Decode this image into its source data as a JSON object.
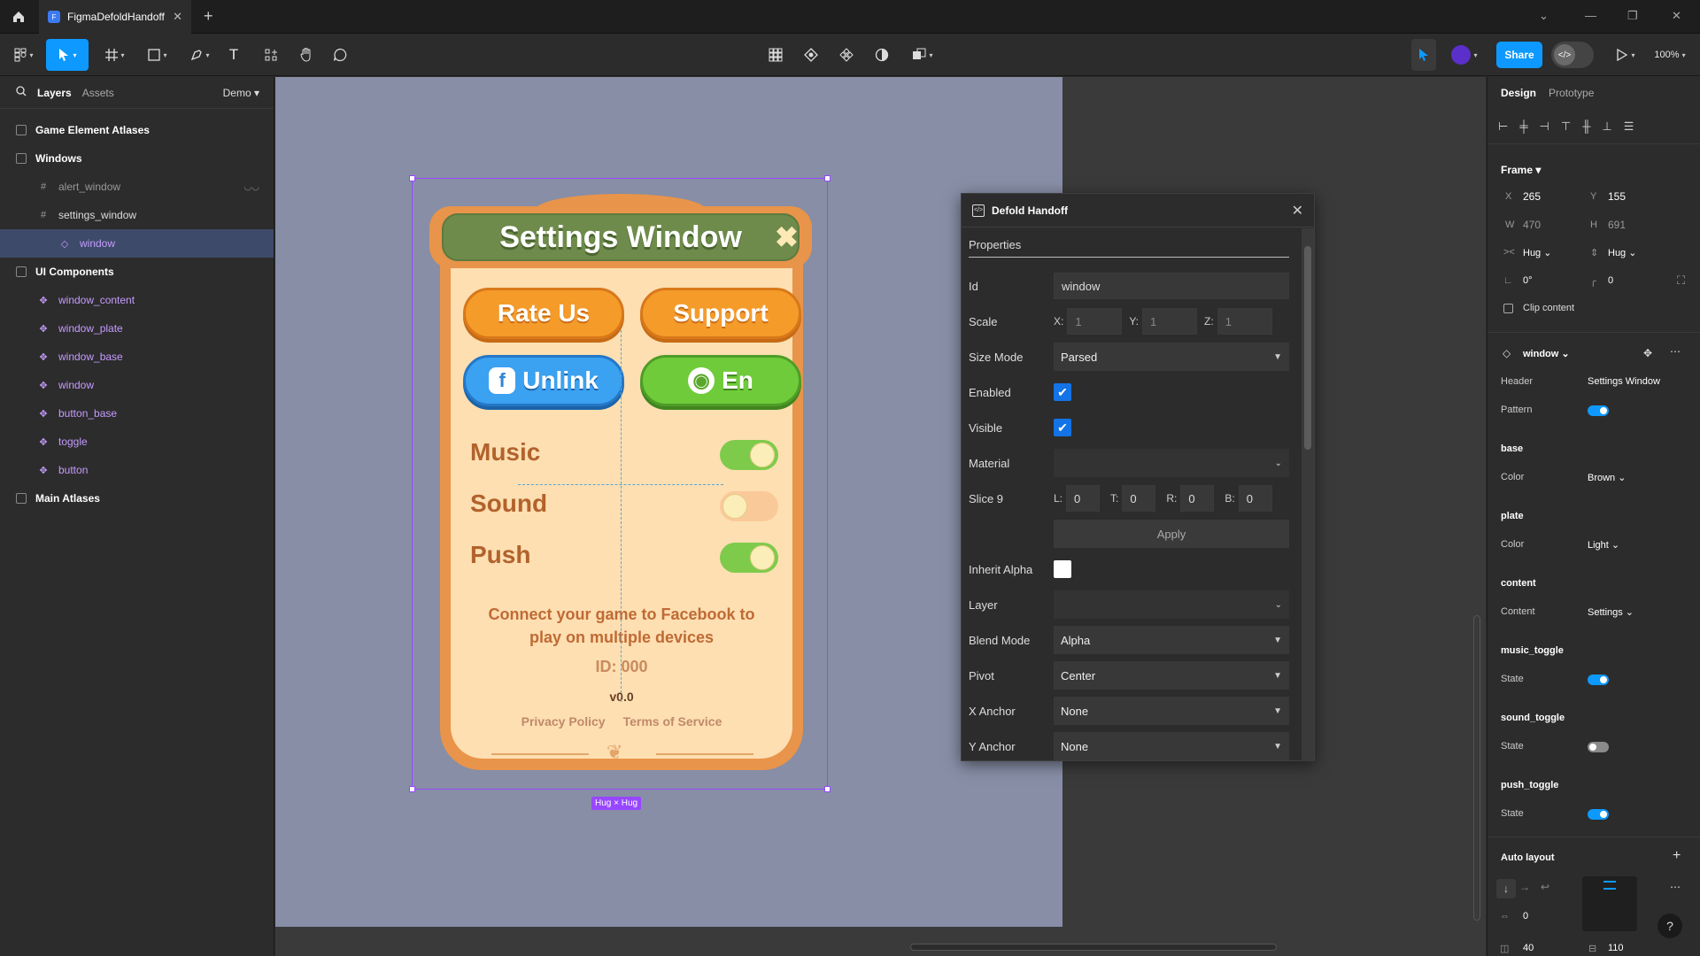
{
  "tabbar": {
    "tab_title": "FigmaDefoldHandoff",
    "tab_icon": "F"
  },
  "toolbar": {
    "share_label": "Share",
    "zoom": "100%"
  },
  "left": {
    "tabs": [
      "Layers",
      "Assets"
    ],
    "page_select": "Demo",
    "layers": [
      {
        "label": "Game Element Atlases"
      },
      {
        "label": "Windows"
      },
      {
        "label": "alert_window"
      },
      {
        "label": "settings_window"
      },
      {
        "label": "window"
      },
      {
        "label": "UI Components"
      },
      {
        "label": "window_content"
      },
      {
        "label": "window_plate"
      },
      {
        "label": "window_base"
      },
      {
        "label": "window"
      },
      {
        "label": "button_base"
      },
      {
        "label": "toggle"
      },
      {
        "label": "button"
      },
      {
        "label": "Main Atlases"
      }
    ]
  },
  "game": {
    "title": "Settings Window",
    "buttons": [
      "Rate Us",
      "Support",
      "Unlink",
      "En"
    ],
    "toggles": [
      {
        "label": "Music",
        "on": true
      },
      {
        "label": "Sound",
        "on": false
      },
      {
        "label": "Push",
        "on": true
      }
    ],
    "message": "Connect your game to Facebook to play on multiple devices",
    "id_text": "ID: 000",
    "version": "v0.0",
    "privacy": "Privacy Policy",
    "terms": "Terms of Service",
    "hug_label": "Hug × Hug"
  },
  "plugin": {
    "title": "Defold Handoff",
    "section": "Properties",
    "id_label": "Id",
    "id_value": "window",
    "scale_label": "Scale",
    "scale_x": "1",
    "scale_y": "1",
    "scale_z": "1",
    "size_mode_label": "Size Mode",
    "size_mode": "Parsed",
    "enabled_label": "Enabled",
    "visible_label": "Visible",
    "material_label": "Material",
    "slice_label": "Slice 9",
    "slice_l": "0",
    "slice_t": "0",
    "slice_r": "0",
    "slice_b": "0",
    "apply_label": "Apply",
    "inherit_label": "Inherit Alpha",
    "layer_label": "Layer",
    "blend_label": "Blend Mode",
    "blend": "Alpha",
    "pivot_label": "Pivot",
    "pivot": "Center",
    "xanchor_label": "X Anchor",
    "xanchor": "None",
    "yanchor_label": "Y Anchor",
    "yanchor": "None",
    "axis": {
      "x": "X:",
      "y": "Y:",
      "z": "Z:",
      "l": "L:",
      "t": "T:",
      "r": "R:",
      "b": "B:"
    }
  },
  "right": {
    "tabs": [
      "Design",
      "Prototype"
    ],
    "frame_label": "Frame",
    "x_lab": "X",
    "x": "265",
    "y_lab": "Y",
    "y": "155",
    "w_lab": "W",
    "w": "470",
    "h_lab": "H",
    "h": "691",
    "hug_w": "Hug",
    "hug_h": "Hug",
    "rotation": "0°",
    "radius": "0",
    "clip": "Clip content",
    "component": "window",
    "header_lab": "Header",
    "header_val": "Settings Window",
    "pattern_lab": "Pattern",
    "base_h": "base",
    "plate_h": "plate",
    "content_h": "content",
    "color_lab": "Color",
    "base_color": "Brown",
    "plate_color": "Light",
    "content_lab": "Content",
    "content_val": "Settings",
    "music_h": "music_toggle",
    "sound_h": "sound_toggle",
    "push_h": "push_toggle",
    "state_lab": "State",
    "auto_layout": "Auto layout",
    "gap": "0",
    "pad_h": "40",
    "pad_v": "110"
  },
  "colors": {
    "accent": "#0d99ff",
    "component": "#c59bff",
    "selection": "#9747ff"
  }
}
